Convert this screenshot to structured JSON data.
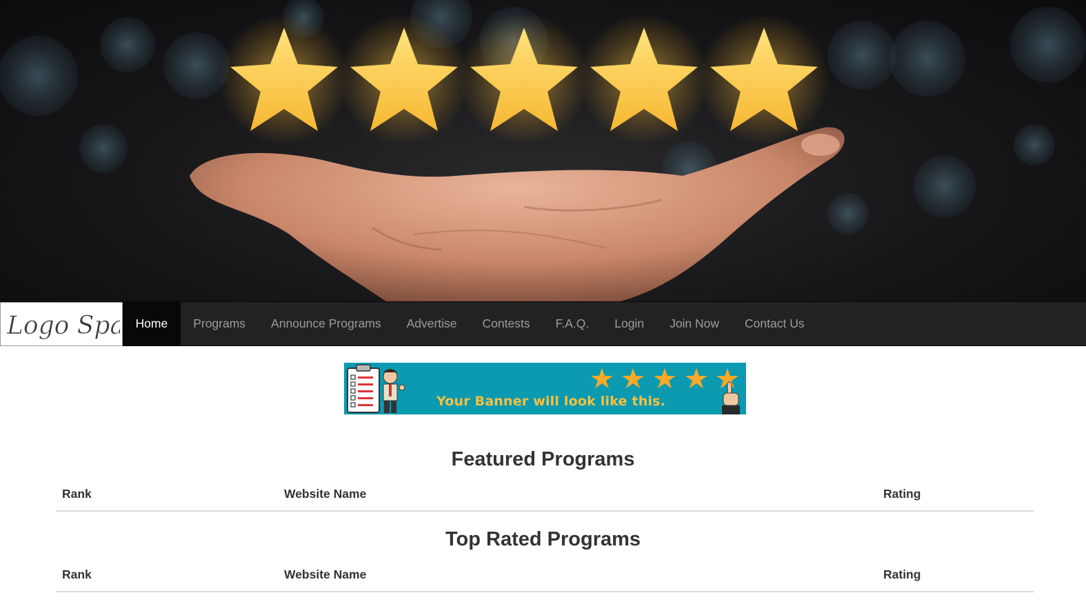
{
  "hero": {
    "image": "hand holding five glowing gold stars",
    "star_color": "#ffd24d"
  },
  "navbar": {
    "logo_text": "Logo Space",
    "items": [
      {
        "label": "Home",
        "active": true
      },
      {
        "label": "Programs",
        "active": false
      },
      {
        "label": "Announce Programs",
        "active": false
      },
      {
        "label": "Advertise",
        "active": false
      },
      {
        "label": "Contests",
        "active": false
      },
      {
        "label": "F.A.Q.",
        "active": false
      },
      {
        "label": "Login",
        "active": false
      },
      {
        "label": "Join Now",
        "active": false
      },
      {
        "label": "Contact Us",
        "active": false
      }
    ]
  },
  "banner": {
    "text": "Your Banner will look like this.",
    "background": "#0c9ab0",
    "text_color": "#f6c141",
    "star_count": 5,
    "icons": [
      "checklist-icon",
      "thumbs-up-man-icon",
      "pointing-hand-icon"
    ]
  },
  "sections": {
    "featured": {
      "title": "Featured Programs",
      "columns": [
        "Rank",
        "Website Name",
        "Rating"
      ],
      "rows": []
    },
    "top_rated": {
      "title": "Top Rated Programs",
      "columns": [
        "Rank",
        "Website Name",
        "Rating"
      ],
      "rows": []
    }
  }
}
